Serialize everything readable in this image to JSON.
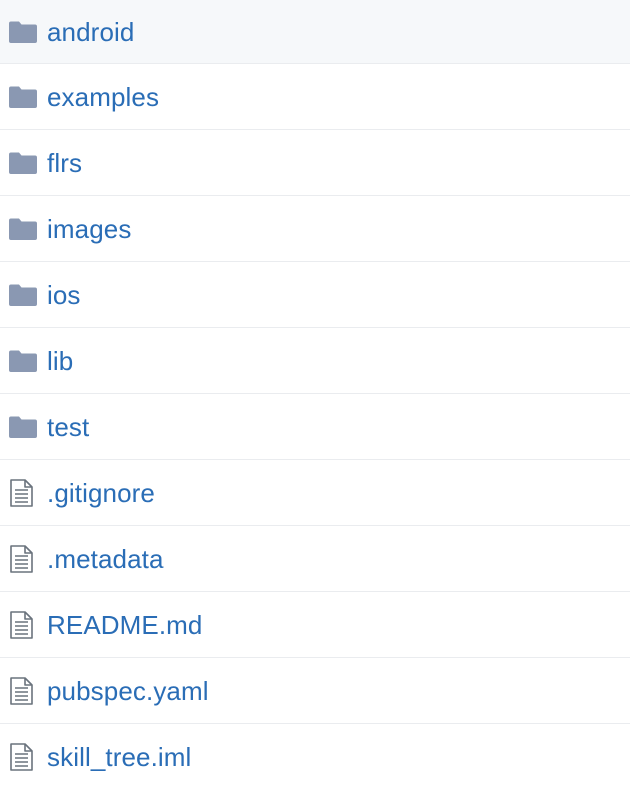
{
  "colors": {
    "link": "#2a6db6",
    "folder_icon": "#8a98b2",
    "file_icon": "#6a737d",
    "row_border": "#eaecef",
    "hover_background": "#f6f8fa"
  },
  "files": [
    {
      "name": "android",
      "type": "folder",
      "icon": "folder-icon"
    },
    {
      "name": "examples",
      "type": "folder",
      "icon": "folder-icon"
    },
    {
      "name": "flrs",
      "type": "folder",
      "icon": "folder-icon"
    },
    {
      "name": "images",
      "type": "folder",
      "icon": "folder-icon"
    },
    {
      "name": "ios",
      "type": "folder",
      "icon": "folder-icon"
    },
    {
      "name": "lib",
      "type": "folder",
      "icon": "folder-icon"
    },
    {
      "name": "test",
      "type": "folder",
      "icon": "folder-icon"
    },
    {
      "name": ".gitignore",
      "type": "file",
      "icon": "file-icon"
    },
    {
      "name": ".metadata",
      "type": "file",
      "icon": "file-icon"
    },
    {
      "name": "README.md",
      "type": "file",
      "icon": "file-icon"
    },
    {
      "name": "pubspec.yaml",
      "type": "file",
      "icon": "file-icon"
    },
    {
      "name": "skill_tree.iml",
      "type": "file",
      "icon": "file-icon"
    }
  ]
}
